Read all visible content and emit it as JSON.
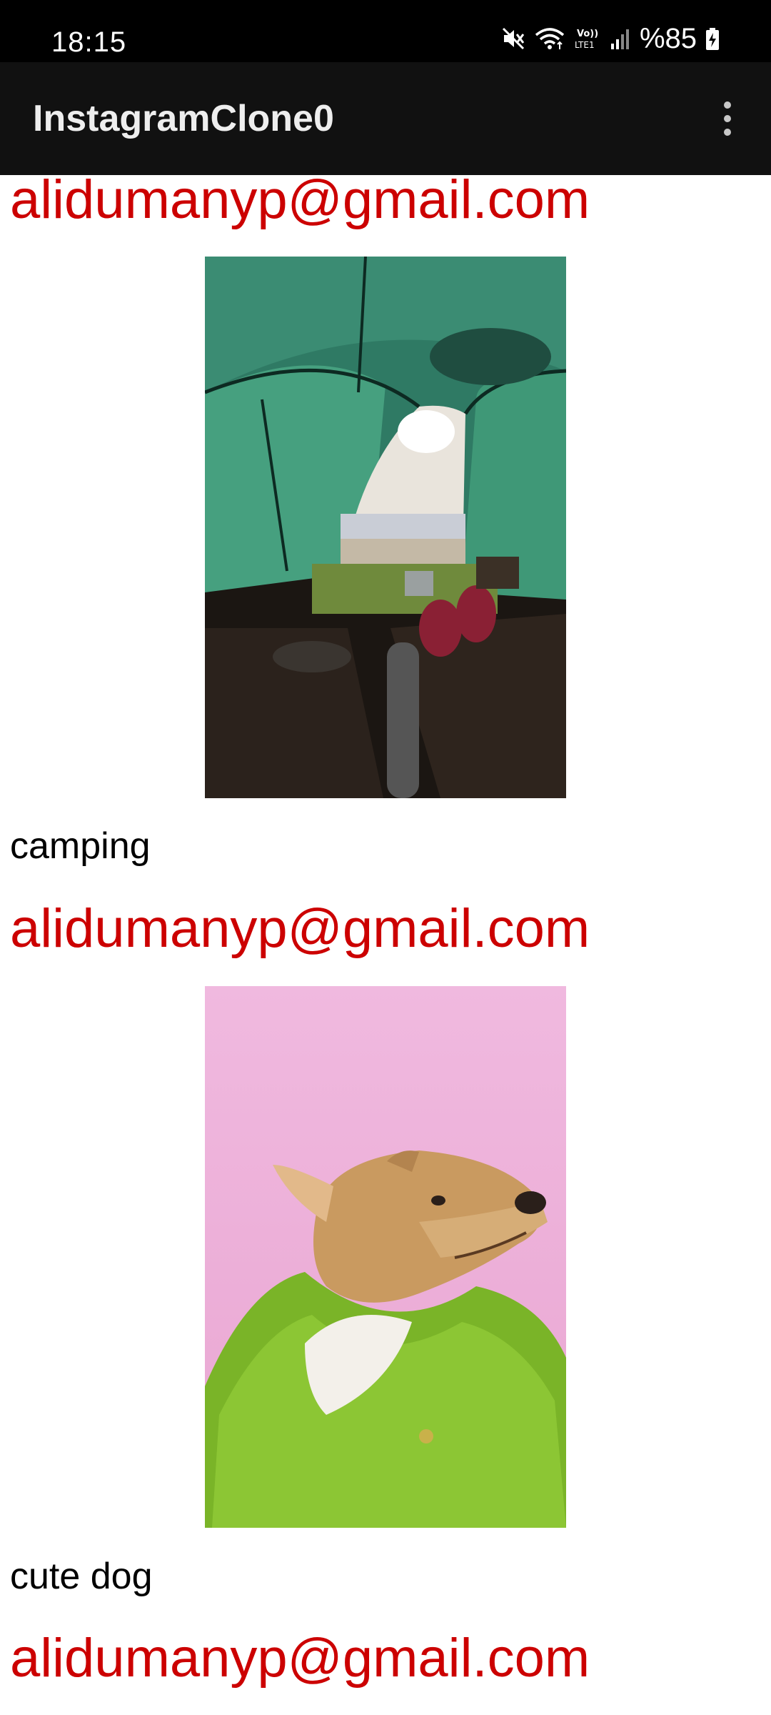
{
  "status_bar": {
    "time": "18:15",
    "battery": "%85",
    "icons": [
      "mute-icon",
      "wifi-icon",
      "volte-icon",
      "signal-icon",
      "battery-charging-icon"
    ]
  },
  "app_bar": {
    "title": "InstagramClone0",
    "menu_icon": "more-vert-icon"
  },
  "feed": {
    "posts": [
      {
        "email": "alidumanyp@gmail.com",
        "image": "tent-camping-photo",
        "caption": "camping"
      },
      {
        "email": "alidumanyp@gmail.com",
        "image": "dog-in-green-coat-photo",
        "caption": "cute dog"
      },
      {
        "email": "alidumanyp@gmail.com"
      }
    ]
  },
  "colors": {
    "status_bar_bg": "#000000",
    "app_bar_bg": "#111111",
    "email_text": "#cc0000",
    "caption_text": "#000000"
  }
}
